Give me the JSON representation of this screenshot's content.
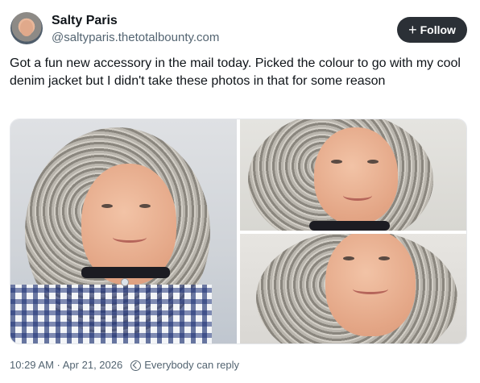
{
  "author": {
    "name": "Salty Paris",
    "handle": "@saltyparis.thetotalbounty.com"
  },
  "follow_button": {
    "label": "Follow",
    "icon": "plus-icon"
  },
  "post": {
    "text": "Got a fun new accessory in the mail today. Picked the colour to go with my cool denim jacket but I didn't take these photos in that for some reason"
  },
  "media": {
    "count": 3
  },
  "meta": {
    "timestamp": "10:29 AM · Apr 21, 2026",
    "reply_setting": "Everybody can reply",
    "reply_icon": "globe-reply-icon"
  },
  "colors": {
    "follow_bg": "#2b3036",
    "secondary_text": "#536471",
    "text": "#0f1419"
  }
}
